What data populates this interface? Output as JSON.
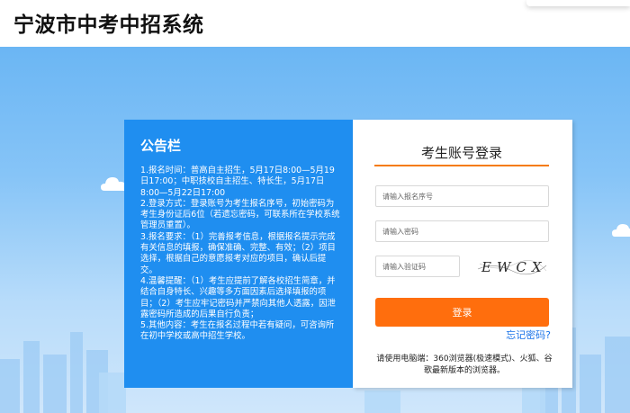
{
  "header": {
    "title": "宁波市中考中招系统"
  },
  "notice": {
    "title": "公告栏",
    "body": "1.报名时间：普高自主招生，5月17日8:00—5月19日17:00；中职技校自主招生、特长生，5月17日8:00—5月22日17:00\n2.登录方式：登录账号为考生报名序号，初始密码为考生身份证后6位（若遗忘密码，可联系所在学校系统管理员重置）。\n3.报名要求：（1）完善报考信息，根据报名提示完成有关信息的填报，确保准确、完整、有效；（2）项目选择，根据自己的意愿报考对应的项目，确认后提交。\n4.温馨提醒：（1）考生应提前了解各校招生简章，并结合自身特长、兴趣等多方面因素后选择填报的项目；（2）考生应牢记密码并严禁向其他人透露，因泄露密码所造成的后果自行负责；\n5.其他内容：考生在报名过程中若有疑问，可咨询所在初中学校或高中招生学校。"
  },
  "login": {
    "title": "考生账号登录",
    "account_placeholder": "请输入报名序号",
    "password_placeholder": "请输入密码",
    "captcha_placeholder": "请输入验证码",
    "captcha_text": "EWCX",
    "submit_label": "登录",
    "forgot_label": "忘记密码?",
    "browser_note": "请使用电脑端：360浏览器(极速模式)、火狐、谷歌最新版本的浏览器。"
  },
  "colors": {
    "notice_bg": "#1f8ef0",
    "accent_orange": "#ff6e0d",
    "link_blue": "#1a73e8"
  }
}
